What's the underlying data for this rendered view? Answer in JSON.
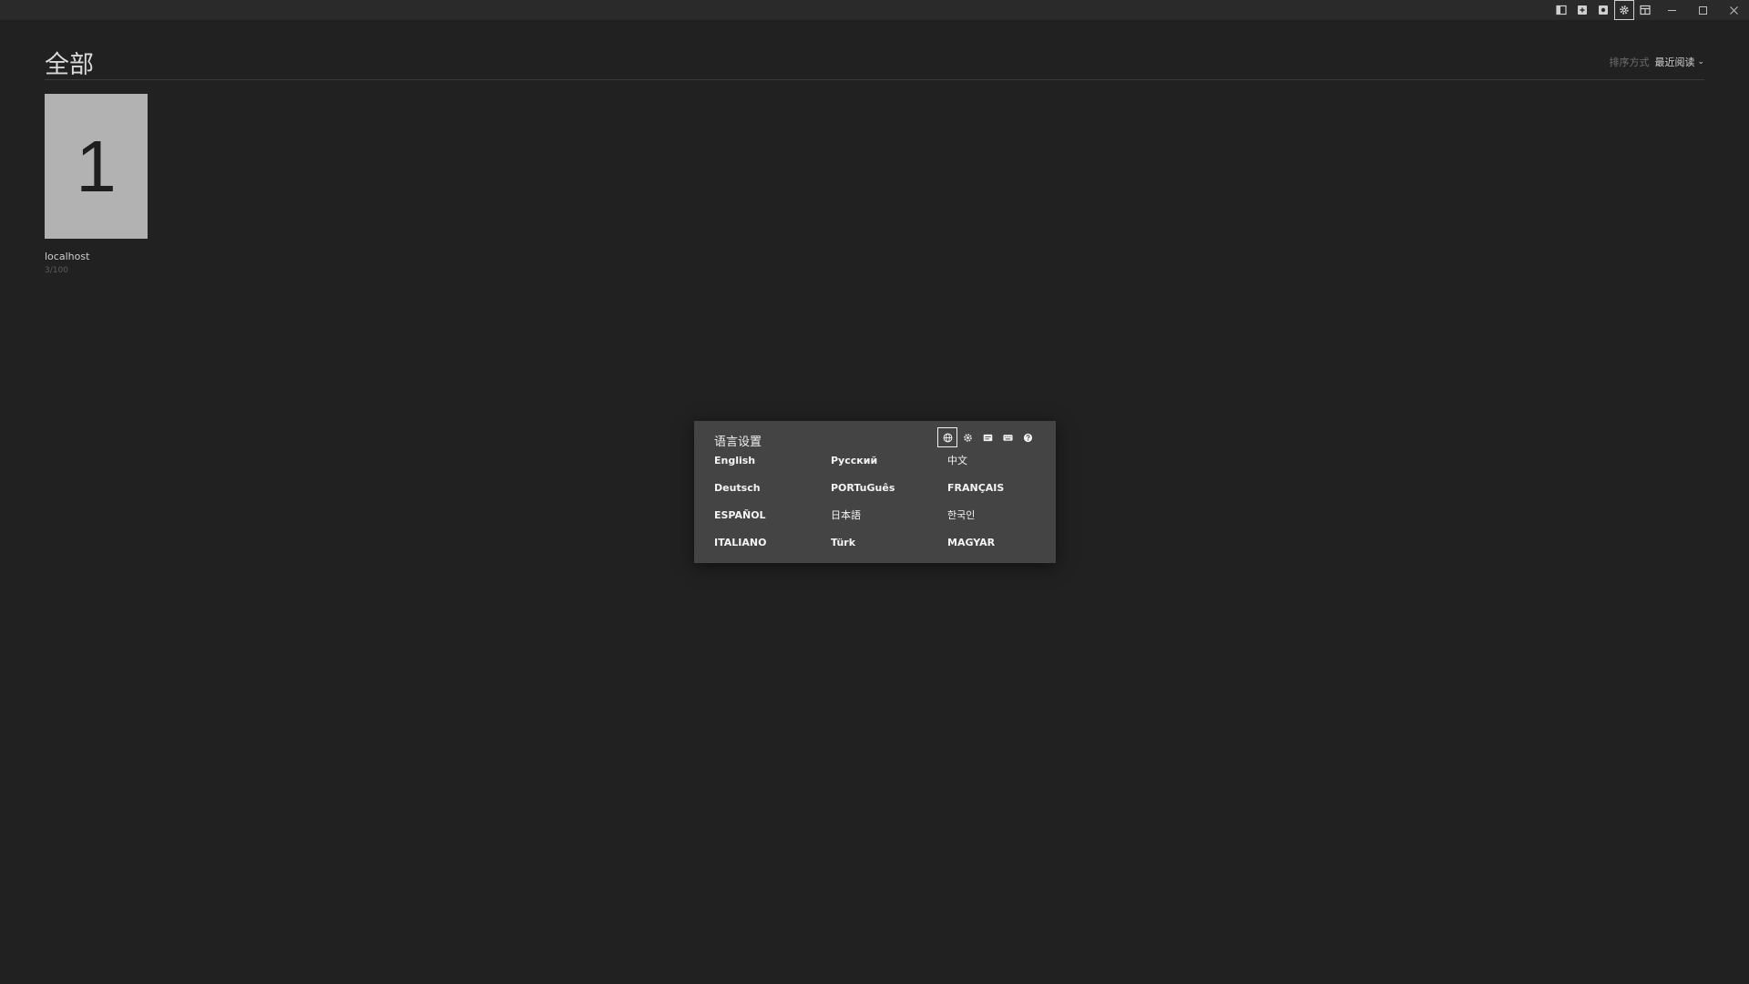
{
  "titlebar": {
    "tools": [
      {
        "icon": "sidebar-toggle-icon",
        "active": false
      },
      {
        "icon": "add-icon",
        "active": false
      },
      {
        "icon": "cloud-icon",
        "active": false
      },
      {
        "icon": "gear-icon",
        "active": true
      },
      {
        "icon": "layout-icon",
        "active": false
      }
    ],
    "window_controls": [
      "minimize-icon",
      "maximize-icon",
      "close-icon"
    ]
  },
  "header": {
    "title": "全部",
    "sort_label": "排序方式",
    "sort_value": "最近阅读"
  },
  "books": [
    {
      "cover_text": "1",
      "title": "localhost",
      "progress": "3/100"
    }
  ],
  "dialog": {
    "title": "语言设置",
    "tabs": [
      {
        "icon": "globe-icon",
        "active": true
      },
      {
        "icon": "gear-icon",
        "active": false
      },
      {
        "icon": "subtitles-icon",
        "active": false
      },
      {
        "icon": "keyboard-icon",
        "active": false
      },
      {
        "icon": "help-icon",
        "active": false
      }
    ],
    "languages": [
      "English",
      "Русский",
      "中文",
      "Deutsch",
      "PORTuGuês",
      "FRANÇAIS",
      "ESPAÑOL",
      "日本語",
      "한국인",
      "ITALIANO",
      "Türk",
      "MAGYAR"
    ]
  },
  "colors": {
    "background": "#212121",
    "titlebar": "#2a2a2a",
    "dialog": "#444444",
    "cover": "#b2b2b2"
  }
}
